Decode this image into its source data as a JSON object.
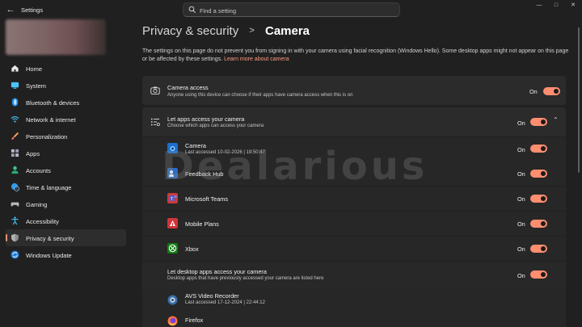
{
  "window": {
    "title": "Settings",
    "search_placeholder": "Find a setting"
  },
  "sidebar": {
    "items": [
      {
        "label": "Home",
        "icon": "home-icon"
      },
      {
        "label": "System",
        "icon": "monitor-icon"
      },
      {
        "label": "Bluetooth & devices",
        "icon": "bluetooth-icon"
      },
      {
        "label": "Network & internet",
        "icon": "wifi-icon"
      },
      {
        "label": "Personalization",
        "icon": "brush-icon"
      },
      {
        "label": "Apps",
        "icon": "apps-icon"
      },
      {
        "label": "Accounts",
        "icon": "person-icon"
      },
      {
        "label": "Time & language",
        "icon": "globe-clock-icon"
      },
      {
        "label": "Gaming",
        "icon": "controller-icon"
      },
      {
        "label": "Accessibility",
        "icon": "accessibility-icon"
      },
      {
        "label": "Privacy & security",
        "icon": "shield-icon"
      },
      {
        "label": "Windows Update",
        "icon": "update-icon"
      }
    ],
    "active": "Privacy & security"
  },
  "header": {
    "parent": "Privacy & security",
    "separator": ">",
    "current": "Camera"
  },
  "description": {
    "text": "The settings on this page do not prevent you from signing in with your camera using facial recognition (Windows Hello). Some desktop apps might not appear on this page or be affected by these settings.",
    "link": "Learn more about camera"
  },
  "camera_access": {
    "title": "Camera access",
    "desc": "Anyone using this device can choose if their apps have camera access when this is on",
    "state": "On"
  },
  "apps_access": {
    "title": "Let apps access your camera",
    "desc": "Choose which apps can access your camera",
    "state": "On",
    "apps": [
      {
        "name": "Camera",
        "sub": "Last accessed 10-02-2026  |  19:50:47",
        "state": "On"
      },
      {
        "name": "Feedback Hub",
        "sub": "",
        "state": "On"
      },
      {
        "name": "Microsoft Teams",
        "sub": "",
        "state": "On"
      },
      {
        "name": "Mobile Plans",
        "sub": "",
        "state": "On"
      },
      {
        "name": "Xbox",
        "sub": "",
        "state": "On"
      }
    ]
  },
  "desktop_access": {
    "title": "Let desktop apps access your camera",
    "desc": "Desktop apps that have previously accessed your camera are listed here",
    "state": "On",
    "apps": [
      {
        "name": "AVS Video Recorder",
        "sub": "Last accessed 17-12-2024  |  22:44:12"
      },
      {
        "name": "Firefox",
        "sub": ""
      }
    ]
  },
  "watermark": "Dealarious",
  "colors": {
    "accent": "#ff8e71",
    "background": "#202020",
    "card": "#2b2b2b"
  }
}
